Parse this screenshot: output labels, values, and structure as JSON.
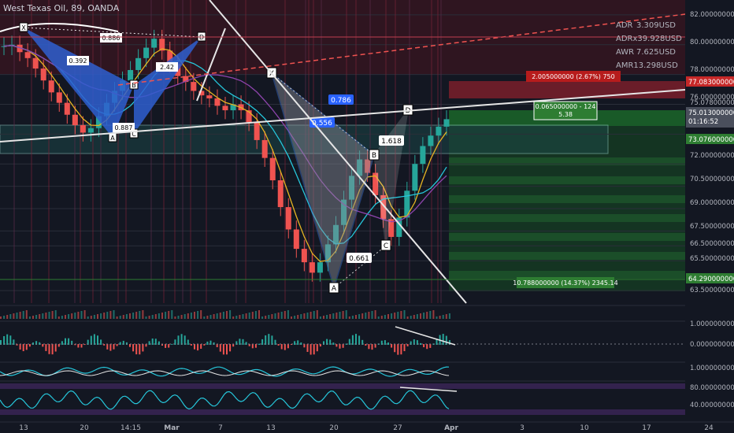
{
  "header": {
    "title": "West Texas Oil, 89, OANDA"
  },
  "indicators": [
    {
      "label": "ADR",
      "value": "3.309USD"
    },
    {
      "label": "ADRx3",
      "value": "9.928USD"
    },
    {
      "label": "AWR",
      "value": "7.625USD"
    },
    {
      "label": "AMR",
      "value": "13.298USD"
    }
  ],
  "price_axis": {
    "ticks": [
      "82.000000000",
      "80.000000000",
      "78.000000000",
      "76.000000000",
      "75.078000000",
      "74.000000000",
      "72.000000000",
      "70.500000000",
      "69.000000000",
      "67.500000000",
      "66.500000000",
      "65.500000000",
      "63.500000000"
    ],
    "current_price": "75.013000000",
    "countdown": "01:16:52",
    "labels": {
      "red_level": "77.083000000",
      "green_level": "73.076000000",
      "stop_level": "64.290000000"
    }
  },
  "time_axis": [
    "13",
    "20",
    "14:15",
    "Mar",
    "7",
    "13",
    "20",
    "27",
    "Apr",
    "3",
    "10",
    "17",
    "24"
  ],
  "position_labels": {
    "risk": "2.005000000 (2.67%) 750",
    "entry_line1": "0.065000000 - 124",
    "entry_line2": "5.38",
    "target": "10.788000000 (14.37%) 2345.14"
  },
  "pattern1": {
    "points": [
      "X",
      "A",
      "B",
      "C",
      "D"
    ],
    "ratios": [
      "0.886",
      "0.392",
      "0.887",
      "2.42"
    ]
  },
  "pattern2": {
    "points": [
      "X",
      "A",
      "B",
      "C",
      "D"
    ],
    "ratios": [
      "0.786",
      "0.556",
      "1.618",
      "0.661"
    ]
  },
  "oscillators": {
    "osc1_ticks": [
      "1.000000000",
      "0.000000000"
    ],
    "osc2_ticks": [
      "1.000000000"
    ],
    "osc3_ticks": [
      "80.000000000",
      "40.000000000"
    ]
  },
  "colors": {
    "background": "#131722",
    "red_zone": "#7a1e2a",
    "green_zone": "#1b6b2a",
    "pattern_blue": "#2f5fd0",
    "pattern_gray": "#8b8f9a",
    "cyan": "#26c6da",
    "price_label": "#4a4f5c"
  },
  "chart_data": {
    "type": "candlestick",
    "symbol": "West Texas Oil",
    "interval": "89",
    "close": [
      79.9,
      80.0,
      79.5,
      79.1,
      78.4,
      77.6,
      76.8,
      76.1,
      75.3,
      74.6,
      74.1,
      74.4,
      75.2,
      76.1,
      76.9,
      77.6,
      78.3,
      79.1,
      79.8,
      80.4,
      79.6,
      78.7,
      77.9,
      77.5,
      76.9,
      76.6,
      76.4,
      75.9,
      75.6,
      76.0,
      75.6,
      74.8,
      73.6,
      72.4,
      70.9,
      69.1,
      67.6,
      66.3,
      65.4,
      64.7,
      65.4,
      66.6,
      67.9,
      69.6,
      71.2,
      72.3,
      71.4,
      69.9,
      68.3,
      67.1,
      68.4,
      70.2,
      72.0,
      73.2,
      73.9,
      74.5,
      75.0
    ],
    "ylim": [
      62.5,
      83.0
    ],
    "xlabel": "",
    "ylabel": ""
  }
}
